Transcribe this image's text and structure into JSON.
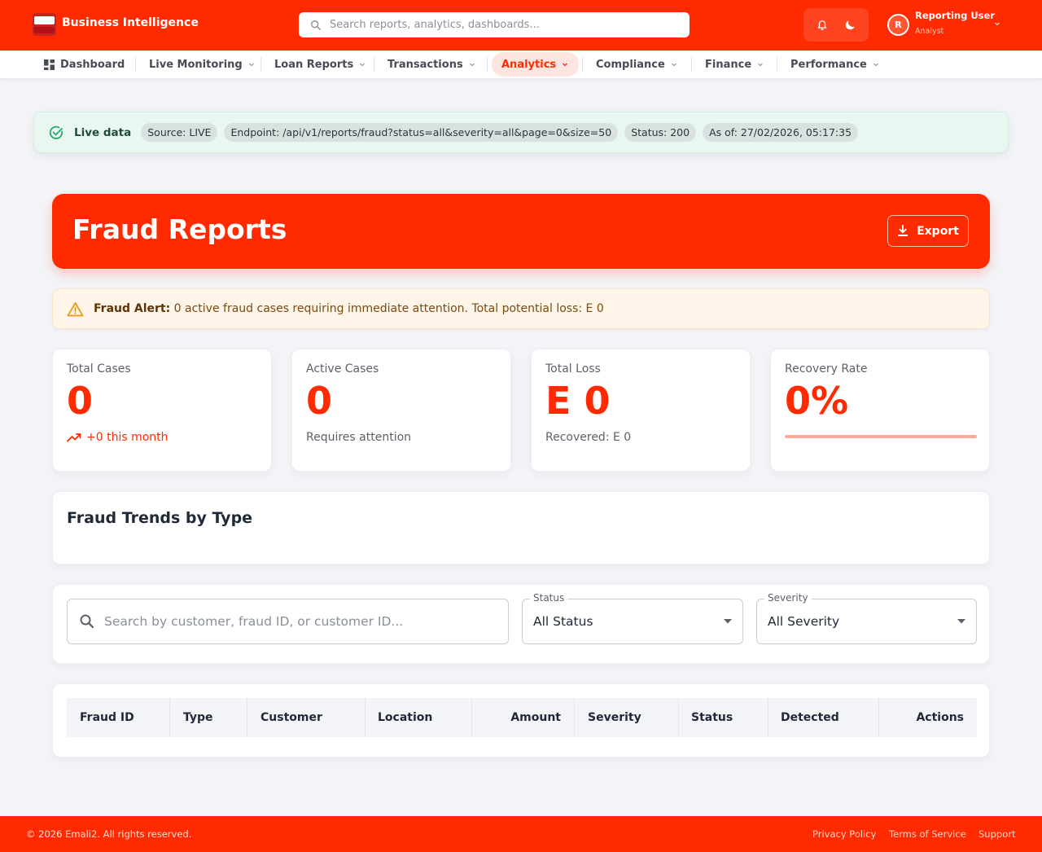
{
  "header": {
    "brand": "Business Intelligence",
    "search_placeholder": "Search reports, analytics, dashboards...",
    "user_initial": "R",
    "user_name": "Reporting User",
    "user_role": "Analyst",
    "icons": [
      "bell-icon",
      "moon-icon"
    ]
  },
  "nav": {
    "items": [
      {
        "label": "Dashboard"
      },
      {
        "label": "Live Monitoring"
      },
      {
        "label": "Loan Reports"
      },
      {
        "label": "Transactions"
      },
      {
        "label": "Analytics",
        "active": true
      },
      {
        "label": "Compliance"
      },
      {
        "label": "Finance"
      },
      {
        "label": "Performance"
      }
    ]
  },
  "live": {
    "label": "Live data",
    "source": "Source: LIVE",
    "endpoint": "Endpoint: /api/v1/reports/fraud?status=all&severity=all&page=0&size=50",
    "status": "Status: 200",
    "as_of": "As of: 27/02/2026, 05:17:35"
  },
  "hero": {
    "title": "Fraud Reports",
    "export_label": "Export"
  },
  "alert": {
    "prefix": "Fraud Alert:",
    "message": " 0 active fraud cases requiring immediate attention. Total potential loss: E 0"
  },
  "stats": [
    {
      "title": "Total Cases",
      "value": "0",
      "sub": "+0 this month"
    },
    {
      "title": "Active Cases",
      "value": "0",
      "sub": "Requires attention"
    },
    {
      "title": "Total Loss",
      "value": "E 0",
      "sub": "Recovered: E 0"
    },
    {
      "title": "Recovery Rate",
      "value": "0%",
      "progress": 0
    }
  ],
  "trends": {
    "title": "Fraud Trends by Type"
  },
  "filters": {
    "search_placeholder": "Search by customer, fraud ID, or customer ID...",
    "status_label": "Status",
    "status_value": "All Status",
    "severity_label": "Severity",
    "severity_value": "All Severity"
  },
  "table": {
    "columns": [
      "Fraud ID",
      "Type",
      "Customer",
      "Location",
      "Amount",
      "Severity",
      "Status",
      "Detected",
      "Actions"
    ]
  },
  "footer": {
    "copyright": "© 2026 Emali2. All rights reserved.",
    "links": [
      "Privacy Policy",
      "Terms of Service",
      "Support"
    ]
  },
  "colors": {
    "primary": "#ff2a00",
    "live_bg": "#e9f7f1",
    "alert_bg": "#fff5e8"
  }
}
